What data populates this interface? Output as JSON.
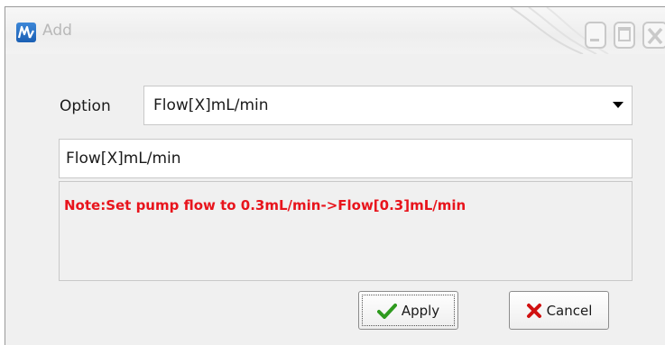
{
  "window": {
    "title": "Add",
    "app_icon": "mass-spec-logo-icon"
  },
  "form": {
    "option_label": "Option",
    "option_selected": "Flow[X]mL/min",
    "expression_value": "Flow[X]mL/min",
    "note": "Note:Set pump flow to 0.3mL/min->Flow[0.3]mL/min"
  },
  "buttons": {
    "apply_label": "Apply",
    "cancel_label": "Cancel"
  },
  "colors": {
    "note_text": "#e8141c",
    "apply_icon": "#2e9a1e",
    "cancel_icon": "#d01010",
    "app_icon": "#1a5fb4"
  }
}
